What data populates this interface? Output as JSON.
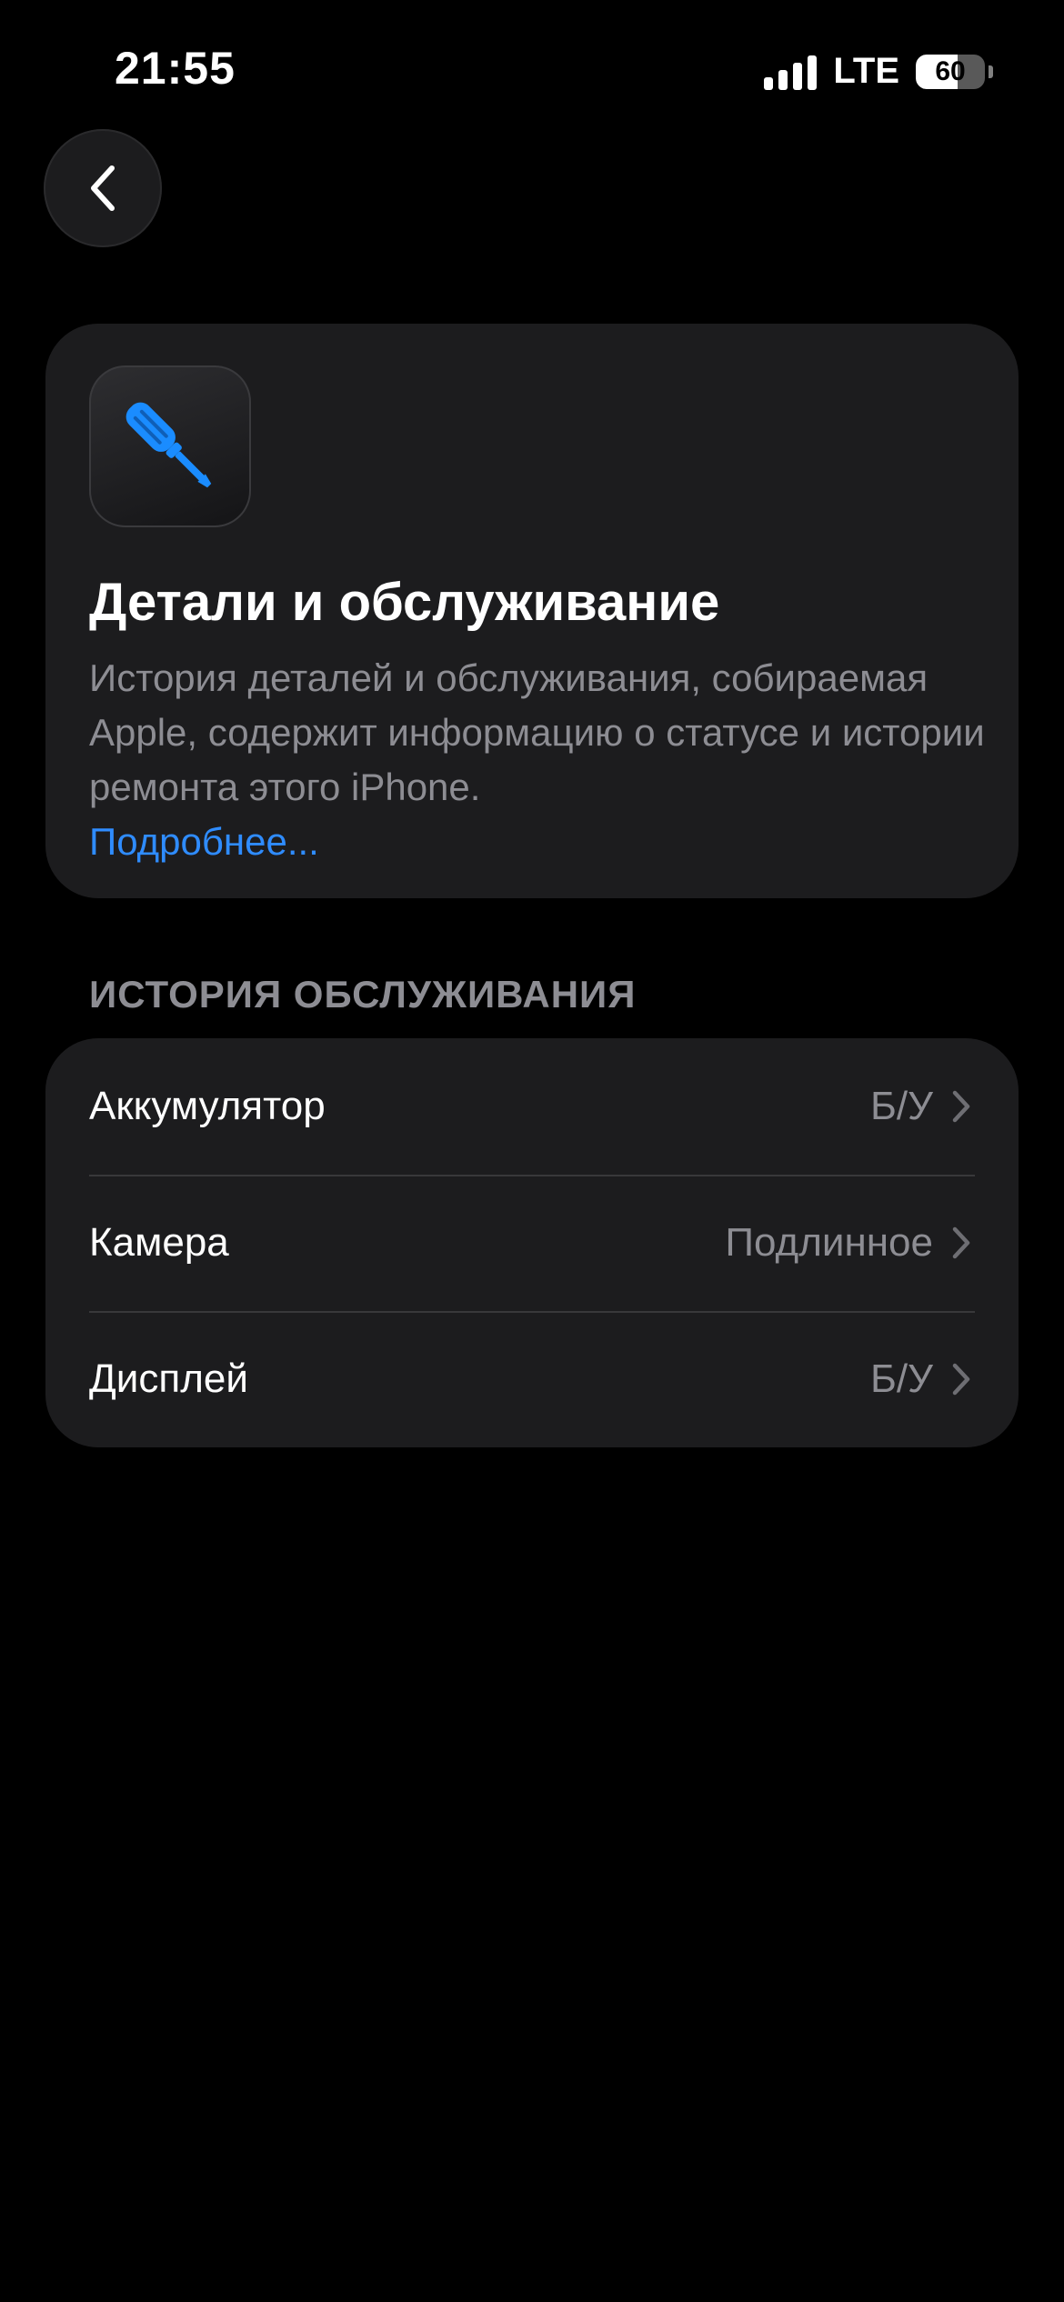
{
  "status_bar": {
    "time": "21:55",
    "network": "LTE",
    "battery_level": "60",
    "battery_percent": 60,
    "signal_bars": 4
  },
  "navigation": {
    "back_icon": "chevron-left-icon"
  },
  "info_card": {
    "icon": "screwdriver-icon",
    "icon_color": "#1a8cff",
    "title": "Детали и обслуживание",
    "description": "История деталей и обслуживания, собираемая Apple, содержит информацию о статусе и истории ремонта этого iPhone.",
    "link": "Подробнее..."
  },
  "service_history": {
    "header": "ИСТОРИЯ ОБСЛУЖИВАНИЯ",
    "rows": [
      {
        "label": "Аккумулятор",
        "value": "Б/У"
      },
      {
        "label": "Камера",
        "value": "Подлинное"
      },
      {
        "label": "Дисплей",
        "value": "Б/У"
      }
    ]
  },
  "colors": {
    "background": "#000000",
    "card": "#1c1c1e",
    "secondary_text": "#8d8d93",
    "link": "#2f8cff"
  }
}
